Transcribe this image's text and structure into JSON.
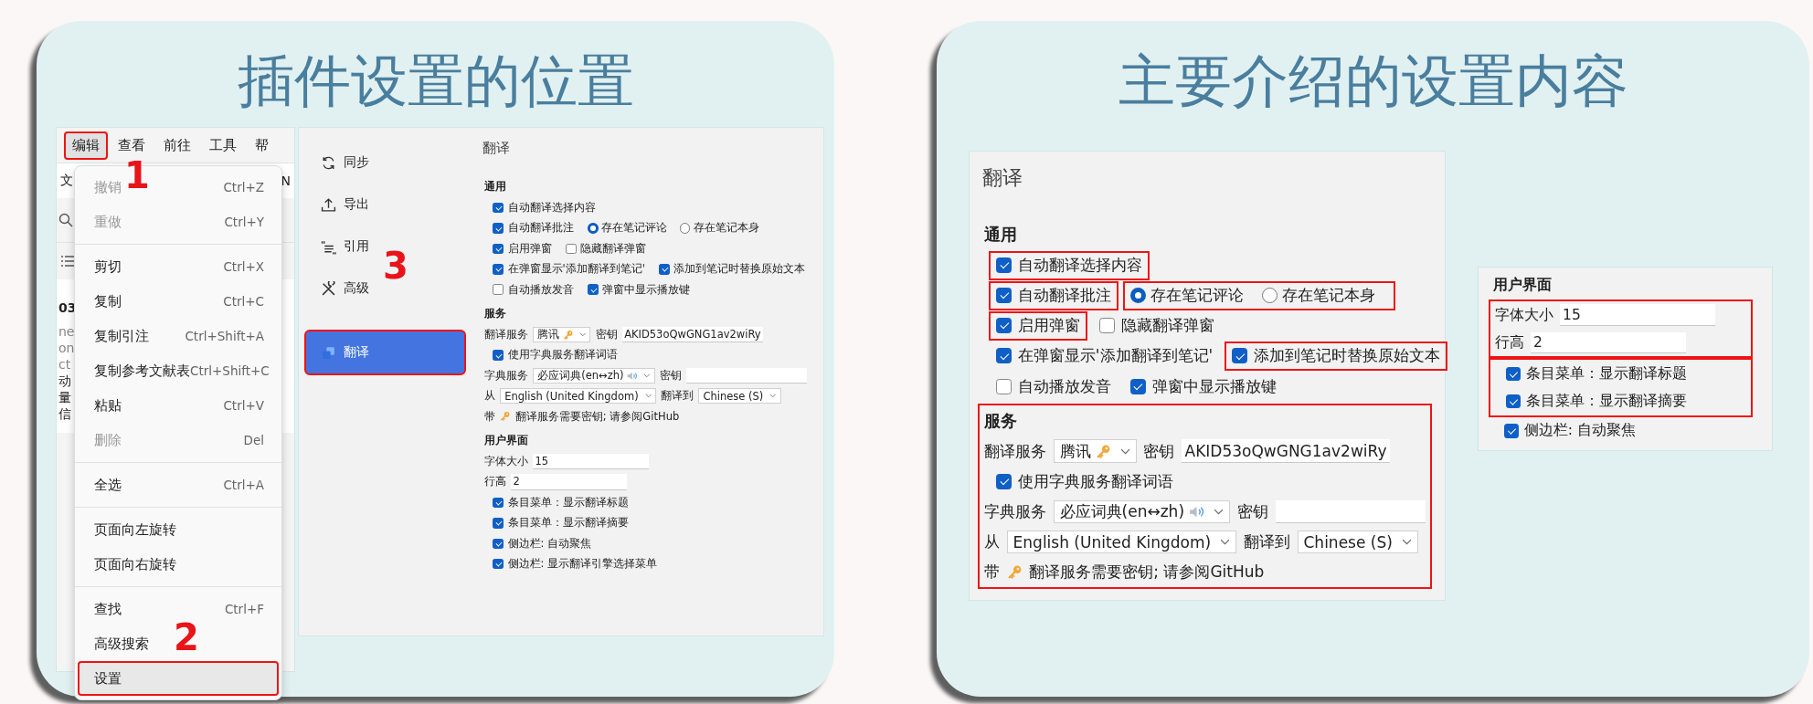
{
  "left_card": {
    "title": "插件设置的位置",
    "app": {
      "menu_bar": [
        {
          "label": "编辑",
          "selected": true,
          "annotated": true,
          "callout": "1"
        },
        {
          "label": "查看",
          "selected": false,
          "annotated": false
        },
        {
          "label": "前往",
          "selected": false,
          "annotated": false
        },
        {
          "label": "工具",
          "selected": false,
          "annotated": false
        },
        {
          "label": "帮",
          "selected": false,
          "annotated": false
        }
      ],
      "toolbar_fragments": [
        "文",
        "N"
      ],
      "list_fragments": [
        "03",
        "ne",
        "on",
        "ct",
        "动",
        "量",
        "信"
      ],
      "menu": [
        {
          "kind": "item",
          "label": "撤销",
          "shortcut": "Ctrl+Z",
          "disabled": true,
          "selected": false,
          "annotated": false
        },
        {
          "kind": "item",
          "label": "重做",
          "shortcut": "Ctrl+Y",
          "disabled": true,
          "selected": false,
          "annotated": false
        },
        {
          "kind": "separator"
        },
        {
          "kind": "item",
          "label": "剪切",
          "shortcut": "Ctrl+X",
          "disabled": false,
          "selected": false,
          "annotated": false
        },
        {
          "kind": "item",
          "label": "复制",
          "shortcut": "Ctrl+C",
          "disabled": false,
          "selected": false,
          "annotated": false
        },
        {
          "kind": "item",
          "label": "复制引注",
          "shortcut": "Ctrl+Shift+A",
          "disabled": false,
          "selected": false,
          "annotated": false
        },
        {
          "kind": "item",
          "label": "复制参考文献表",
          "shortcut": "Ctrl+Shift+C",
          "disabled": false,
          "selected": false,
          "annotated": false
        },
        {
          "kind": "item",
          "label": "粘贴",
          "shortcut": "Ctrl+V",
          "disabled": false,
          "selected": false,
          "annotated": false
        },
        {
          "kind": "item",
          "label": "删除",
          "shortcut": "Del",
          "disabled": true,
          "selected": false,
          "annotated": false
        },
        {
          "kind": "separator"
        },
        {
          "kind": "item",
          "label": "全选",
          "shortcut": "Ctrl+A",
          "disabled": false,
          "selected": false,
          "annotated": false
        },
        {
          "kind": "separator"
        },
        {
          "kind": "item",
          "label": "页面向左旋转",
          "disabled": false,
          "selected": false,
          "annotated": false
        },
        {
          "kind": "item",
          "label": "页面向右旋转",
          "disabled": false,
          "selected": false,
          "annotated": false
        },
        {
          "kind": "separator"
        },
        {
          "kind": "item",
          "label": "查找",
          "shortcut": "Ctrl+F",
          "disabled": false,
          "selected": false,
          "annotated": false
        },
        {
          "kind": "item",
          "label": "高级搜索",
          "disabled": false,
          "selected": false,
          "annotated": false
        },
        {
          "kind": "item",
          "label": "设置",
          "disabled": false,
          "selected": true,
          "annotated": true,
          "callout": "2"
        }
      ]
    },
    "settings_window": {
      "sidebar": [
        {
          "label": "同步",
          "selected": false,
          "annotated": false
        },
        {
          "label": "导出",
          "selected": false,
          "annotated": false
        },
        {
          "label": "引用",
          "selected": false,
          "annotated": false
        },
        {
          "label": "高级",
          "selected": false,
          "annotated": false
        },
        {
          "label": "翻译",
          "selected": true,
          "annotated": true,
          "callout": "3"
        }
      ],
      "panel": {
        "title": "翻译",
        "sections": [
          {
            "heading": "通用",
            "rows": [
              {
                "kind": "checks",
                "items": [
                  {
                    "kind": "checkbox",
                    "label": "自动翻译选择内容",
                    "checked": true
                  }
                ]
              },
              {
                "kind": "checks",
                "items": [
                  {
                    "kind": "checkbox",
                    "label": "自动翻译批注",
                    "checked": true
                  },
                  {
                    "kind": "radio-group",
                    "options": [
                      {
                        "label": "存在笔记评论",
                        "selected": true
                      },
                      {
                        "label": "存在笔记本身",
                        "selected": false
                      }
                    ]
                  }
                ]
              },
              {
                "kind": "checks",
                "items": [
                  {
                    "kind": "checkbox",
                    "label": "启用弹窗",
                    "checked": true
                  },
                  {
                    "kind": "checkbox",
                    "label": "隐藏翻译弹窗",
                    "checked": false
                  }
                ]
              },
              {
                "kind": "checks",
                "items": [
                  {
                    "kind": "checkbox",
                    "label": "在弹窗显示'添加翻译到笔记'",
                    "checked": true
                  },
                  {
                    "kind": "checkbox",
                    "label": "添加到笔记时替换原始文本",
                    "checked": true
                  }
                ]
              },
              {
                "kind": "checks",
                "items": [
                  {
                    "kind": "checkbox",
                    "label": "自动播放发音",
                    "checked": false
                  },
                  {
                    "kind": "checkbox",
                    "label": "弹窗中显示播放键",
                    "checked": true
                  }
                ]
              }
            ]
          },
          {
            "heading": "服务",
            "rows": [
              {
                "kind": "controls",
                "items": [
                  {
                    "kind": "label",
                    "text": "翻译服务"
                  },
                  {
                    "kind": "key-select",
                    "value": "腾讯"
                  },
                  {
                    "kind": "label",
                    "text": "密钥"
                  },
                  {
                    "kind": "input",
                    "value": "AKID53oQwGNG1av2wiRy"
                  }
                ]
              },
              {
                "kind": "checks",
                "items": [
                  {
                    "kind": "checkbox",
                    "label": "使用字典服务翻译词语",
                    "checked": true
                  }
                ]
              },
              {
                "kind": "controls",
                "items": [
                  {
                    "kind": "label",
                    "text": "字典服务"
                  },
                  {
                    "kind": "sound-select",
                    "value": "必应词典(en↔zh)"
                  },
                  {
                    "kind": "label",
                    "text": "密钥"
                  },
                  {
                    "kind": "input"
                  }
                ]
              },
              {
                "kind": "controls",
                "items": [
                  {
                    "kind": "label",
                    "text": "从"
                  },
                  {
                    "kind": "select",
                    "value": "English (United Kingdom)"
                  },
                  {
                    "kind": "label",
                    "text": "翻译到"
                  },
                  {
                    "kind": "select",
                    "value": "Chinese (S)"
                  }
                ]
              },
              {
                "kind": "note",
                "prefix": "带",
                "text": "翻译服务需要密钥; 请参阅GitHub"
              }
            ]
          },
          {
            "heading": "用户界面",
            "rows": [
              {
                "kind": "field",
                "label": "字体大小",
                "value": "15"
              },
              {
                "kind": "field",
                "label": "行高",
                "value": "2"
              },
              {
                "kind": "checks",
                "items": [
                  {
                    "kind": "checkbox",
                    "label": "条目菜单：显示翻译标题",
                    "checked": true
                  }
                ]
              },
              {
                "kind": "checks",
                "items": [
                  {
                    "kind": "checkbox",
                    "label": "条目菜单：显示翻译摘要",
                    "checked": true
                  }
                ]
              },
              {
                "kind": "checks",
                "items": [
                  {
                    "kind": "checkbox",
                    "label": "侧边栏: 自动聚焦",
                    "checked": true
                  }
                ]
              },
              {
                "kind": "checks",
                "items": [
                  {
                    "kind": "checkbox",
                    "label": "侧边栏: 显示翻译引擎选择菜单",
                    "checked": true
                  }
                ]
              }
            ]
          }
        ]
      }
    }
  },
  "right_card": {
    "title": "主要介绍的设置内容",
    "main_panel": {
      "title": "翻译",
      "sections": [
        {
          "heading": "通用",
          "annotated": false,
          "rows": [
            {
              "kind": "checks",
              "items": [
                {
                  "kind": "checkbox",
                  "label": "自动翻译选择内容",
                  "checked": true,
                  "annotated": true
                }
              ]
            },
            {
              "kind": "checks",
              "items": [
                {
                  "kind": "checkbox",
                  "label": "自动翻译批注",
                  "checked": true,
                  "annotated": true
                },
                {
                  "kind": "radio-group",
                  "annotated": true,
                  "options": [
                    {
                      "label": "存在笔记评论",
                      "selected": true
                    },
                    {
                      "label": "存在笔记本身",
                      "selected": false
                    }
                  ]
                }
              ]
            },
            {
              "kind": "checks",
              "items": [
                {
                  "kind": "checkbox",
                  "label": "启用弹窗",
                  "checked": true,
                  "annotated": true
                },
                {
                  "kind": "checkbox",
                  "label": "隐藏翻译弹窗",
                  "checked": false,
                  "annotated": false
                }
              ]
            },
            {
              "kind": "checks",
              "items": [
                {
                  "kind": "checkbox",
                  "label": "在弹窗显示'添加翻译到笔记'",
                  "checked": true,
                  "annotated": false
                },
                {
                  "kind": "checkbox",
                  "label": "添加到笔记时替换原始文本",
                  "checked": true,
                  "annotated": true
                }
              ]
            },
            {
              "kind": "checks",
              "items": [
                {
                  "kind": "checkbox",
                  "label": "自动播放发音",
                  "checked": false,
                  "annotated": false
                },
                {
                  "kind": "checkbox",
                  "label": "弹窗中显示播放键",
                  "checked": true,
                  "annotated": false
                }
              ]
            }
          ]
        },
        {
          "heading": "服务",
          "annotated": true,
          "rows": [
            {
              "kind": "controls",
              "items": [
                {
                  "kind": "label",
                  "text": "翻译服务"
                },
                {
                  "kind": "key-select",
                  "value": "腾讯"
                },
                {
                  "kind": "label",
                  "text": "密钥"
                },
                {
                  "kind": "input",
                  "value": "AKID53oQwGNG1av2wiRy"
                }
              ]
            },
            {
              "kind": "checks",
              "items": [
                {
                  "kind": "checkbox",
                  "label": "使用字典服务翻译词语",
                  "checked": true,
                  "annotated": false
                }
              ]
            },
            {
              "kind": "controls",
              "items": [
                {
                  "kind": "label",
                  "text": "字典服务"
                },
                {
                  "kind": "sound-select",
                  "value": "必应词典(en↔zh)"
                },
                {
                  "kind": "label",
                  "text": "密钥"
                },
                {
                  "kind": "input"
                }
              ]
            },
            {
              "kind": "controls",
              "items": [
                {
                  "kind": "label",
                  "text": "从"
                },
                {
                  "kind": "select",
                  "value": "English (United Kingdom)"
                },
                {
                  "kind": "label",
                  "text": "翻译到"
                },
                {
                  "kind": "select",
                  "value": "Chinese (S)"
                }
              ]
            },
            {
              "kind": "note",
              "prefix": "带",
              "text": "翻译服务需要密钥; 请参阅GitHub"
            }
          ]
        }
      ]
    },
    "ui_panel": {
      "sections": [
        {
          "heading": "用户界面",
          "annotated": false,
          "rows": [
            {
              "kind": "group",
              "annotated": true,
              "rows": [
                {
                  "kind": "field",
                  "label": "字体大小",
                  "value": "15"
                },
                {
                  "kind": "field",
                  "label": "行高",
                  "value": "2"
                }
              ]
            },
            {
              "kind": "group",
              "annotated": true,
              "rows": [
                {
                  "kind": "checks",
                  "items": [
                    {
                      "kind": "checkbox",
                      "label": "条目菜单：显示翻译标题",
                      "checked": true,
                      "annotated": false
                    }
                  ]
                },
                {
                  "kind": "checks",
                  "items": [
                    {
                      "kind": "checkbox",
                      "label": "条目菜单：显示翻译摘要",
                      "checked": true,
                      "annotated": false
                    }
                  ]
                }
              ]
            },
            {
              "kind": "checks",
              "items": [
                {
                  "kind": "checkbox",
                  "label": "侧边栏: 自动聚焦",
                  "checked": true,
                  "annotated": false
                }
              ]
            }
          ]
        }
      ]
    }
  }
}
